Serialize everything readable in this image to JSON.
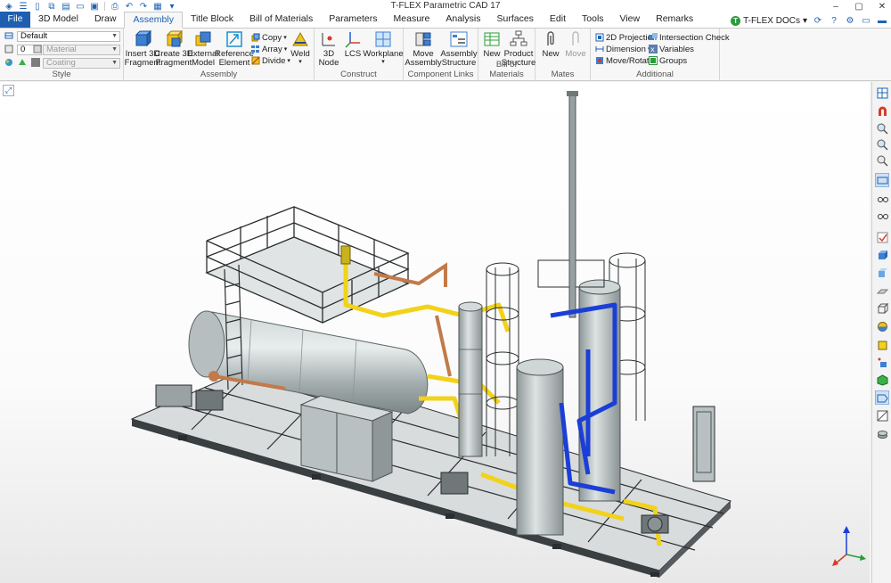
{
  "window": {
    "title": "T-FLEX Parametric CAD 17",
    "controls": [
      "–",
      "▢",
      "✕"
    ]
  },
  "qat": {
    "icons": [
      "app-menu-icon",
      "menu-icon",
      "new-icon",
      "copy-icon",
      "save-icon",
      "open-folder-icon",
      "save-all-icon",
      "print-icon",
      "undo-icon",
      "redo-icon",
      "drawing-icon",
      "customize-icon"
    ]
  },
  "tabs": [
    {
      "label": "File"
    },
    {
      "label": "3D Model"
    },
    {
      "label": "Draw"
    },
    {
      "label": "Assembly"
    },
    {
      "label": "Title Block"
    },
    {
      "label": "Bill of Materials"
    },
    {
      "label": "Parameters"
    },
    {
      "label": "Measure"
    },
    {
      "label": "Analysis"
    },
    {
      "label": "Surfaces"
    },
    {
      "label": "Edit"
    },
    {
      "label": "Tools"
    },
    {
      "label": "View"
    },
    {
      "label": "Remarks"
    }
  ],
  "active_tab": "Assembly",
  "docs": {
    "label": "T-FLEX DOCs",
    "arrow": "▾"
  },
  "ribbon": {
    "style": {
      "label": "Style",
      "layer_value": "Default",
      "level_value": "0",
      "material_placeholder": "Material",
      "coating_placeholder": "Coating"
    },
    "assembly": {
      "label": "Assembly",
      "insert_fragment": "Insert 3D|Fragment",
      "create_fragment": "Create 3D|Fragment",
      "external_model": "External|Model",
      "reference_element": "Reference|Element",
      "copy": "Copy",
      "array": "Array",
      "divide": "Divide",
      "weld": "Weld"
    },
    "construct": {
      "label": "Construct",
      "node": "3D|Node",
      "lcs": "LCS",
      "workplane": "Workplane"
    },
    "component_links": {
      "label": "Component Links",
      "move_assembly": "Move|Assembly",
      "assembly_structure": "Assembly|Structure"
    },
    "bom": {
      "label": "Bill of Materials",
      "new": "New",
      "product_structure": "Product|Structure"
    },
    "mates": {
      "label": "Mates",
      "new": "New",
      "move": "Move"
    },
    "additional": {
      "label": "Additional",
      "projection": "2D Projection",
      "dimension": "Dimension",
      "move_rotate": "Move/Rotate",
      "intersection": "Intersection Check",
      "variables": "Variables",
      "groups": "Groups"
    }
  },
  "colors": {
    "accent": "#1d5fb0",
    "pipe_yellow": "#f2d21a",
    "pipe_blue": "#1b3fd6",
    "pipe_copper": "#c27a4a",
    "steel": "#aeb7b8",
    "frame": "#2a2e30"
  },
  "right_toolbar": {
    "icons": [
      "window-icon",
      "magnet-icon",
      "zoom-icon",
      "zoom-in-icon",
      "zoom-fit-icon",
      "view-mode-icon",
      "eyeglasses-icon",
      "glasses-icon",
      "check-mark-icon",
      "cube-icon",
      "cube-shaded-icon",
      "plane-icon",
      "box-icon",
      "sphere-icon",
      "cube-yellow-icon",
      "points-icon",
      "cube-green-icon",
      "face-icon",
      "section-icon",
      "stack-icon"
    ]
  }
}
